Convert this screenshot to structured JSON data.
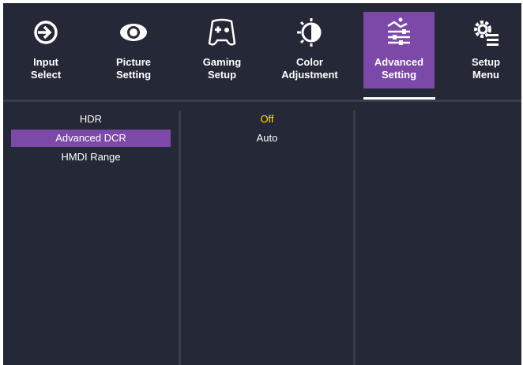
{
  "colors": {
    "background": "#252937",
    "accent": "#7d49a9",
    "selected_value": "#ffe000",
    "text": "#ffffff",
    "divider": "#3a3e4b"
  },
  "tabs": [
    {
      "line1": "Input",
      "line2": "Select",
      "icon": "input-arrow-icon",
      "active": false
    },
    {
      "line1": "Picture",
      "line2": "Setting",
      "icon": "eye-icon",
      "active": false
    },
    {
      "line1": "Gaming",
      "line2": "Setup",
      "icon": "gamepad-icon",
      "active": false
    },
    {
      "line1": "Color",
      "line2": "Adjustment",
      "icon": "color-bulb-icon",
      "active": false
    },
    {
      "line1": "Advanced",
      "line2": "Setting",
      "icon": "advanced-sliders-icon",
      "active": true
    },
    {
      "line1": "Setup",
      "line2": "Menu",
      "icon": "gear-menu-icon",
      "active": false
    }
  ],
  "menu": {
    "items": [
      {
        "label": "HDR",
        "selected": false
      },
      {
        "label": "Advanced DCR",
        "selected": true
      },
      {
        "label": "HMDI Range",
        "selected": false
      }
    ]
  },
  "options": {
    "items": [
      {
        "label": "Off",
        "current": true
      },
      {
        "label": "Auto",
        "current": false
      }
    ]
  }
}
